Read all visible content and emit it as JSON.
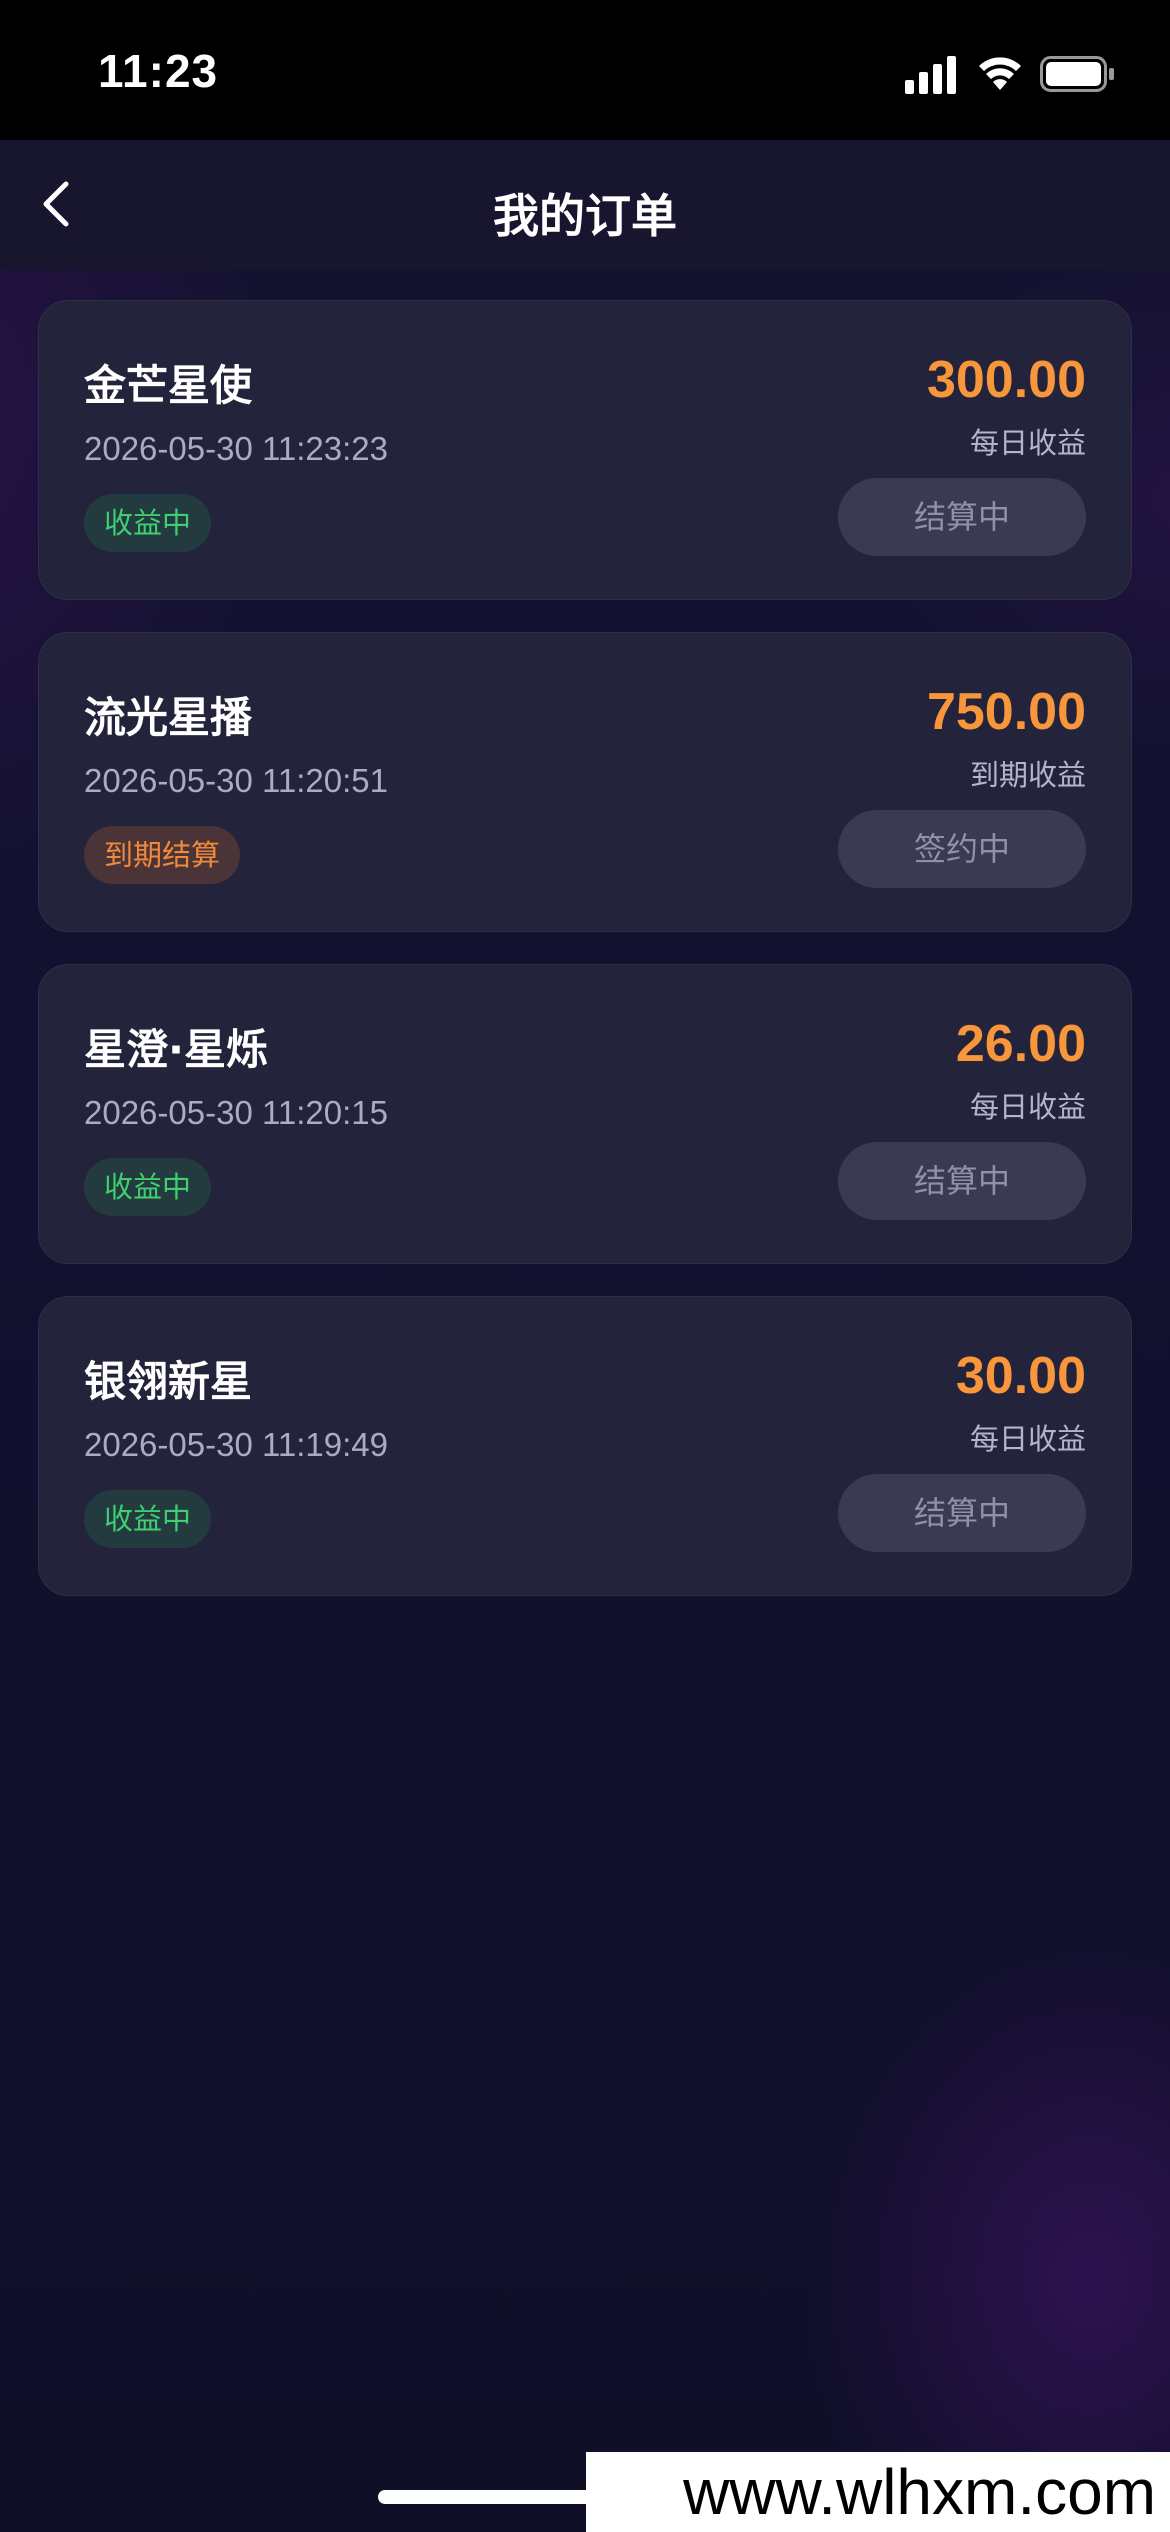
{
  "status_bar": {
    "time": "11:23"
  },
  "nav": {
    "title": "我的订单"
  },
  "orders": [
    {
      "name": "金芒星使",
      "time": "2026-05-30 11:23:23",
      "status": "收益中",
      "status_type": "green",
      "amount": "300.00",
      "amount_caption": "每日收益",
      "action_label": "结算中"
    },
    {
      "name": "流光星播",
      "time": "2026-05-30 11:20:51",
      "status": "到期结算",
      "status_type": "orange",
      "amount": "750.00",
      "amount_caption": "到期收益",
      "action_label": "签约中"
    },
    {
      "name": "星澄·星烁",
      "time": "2026-05-30 11:20:15",
      "status": "收益中",
      "status_type": "green",
      "amount": "26.00",
      "amount_caption": "每日收益",
      "action_label": "结算中"
    },
    {
      "name": "银翎新星",
      "time": "2026-05-30 11:19:49",
      "status": "收益中",
      "status_type": "green",
      "amount": "30.00",
      "amount_caption": "每日收益",
      "action_label": "结算中"
    }
  ],
  "watermark": {
    "text": "www.wlhxm.com"
  },
  "colors": {
    "amount": "#f7963a",
    "status_green": "#3fcf72",
    "status_orange": "#f0893a",
    "card_background": "#23243b"
  }
}
